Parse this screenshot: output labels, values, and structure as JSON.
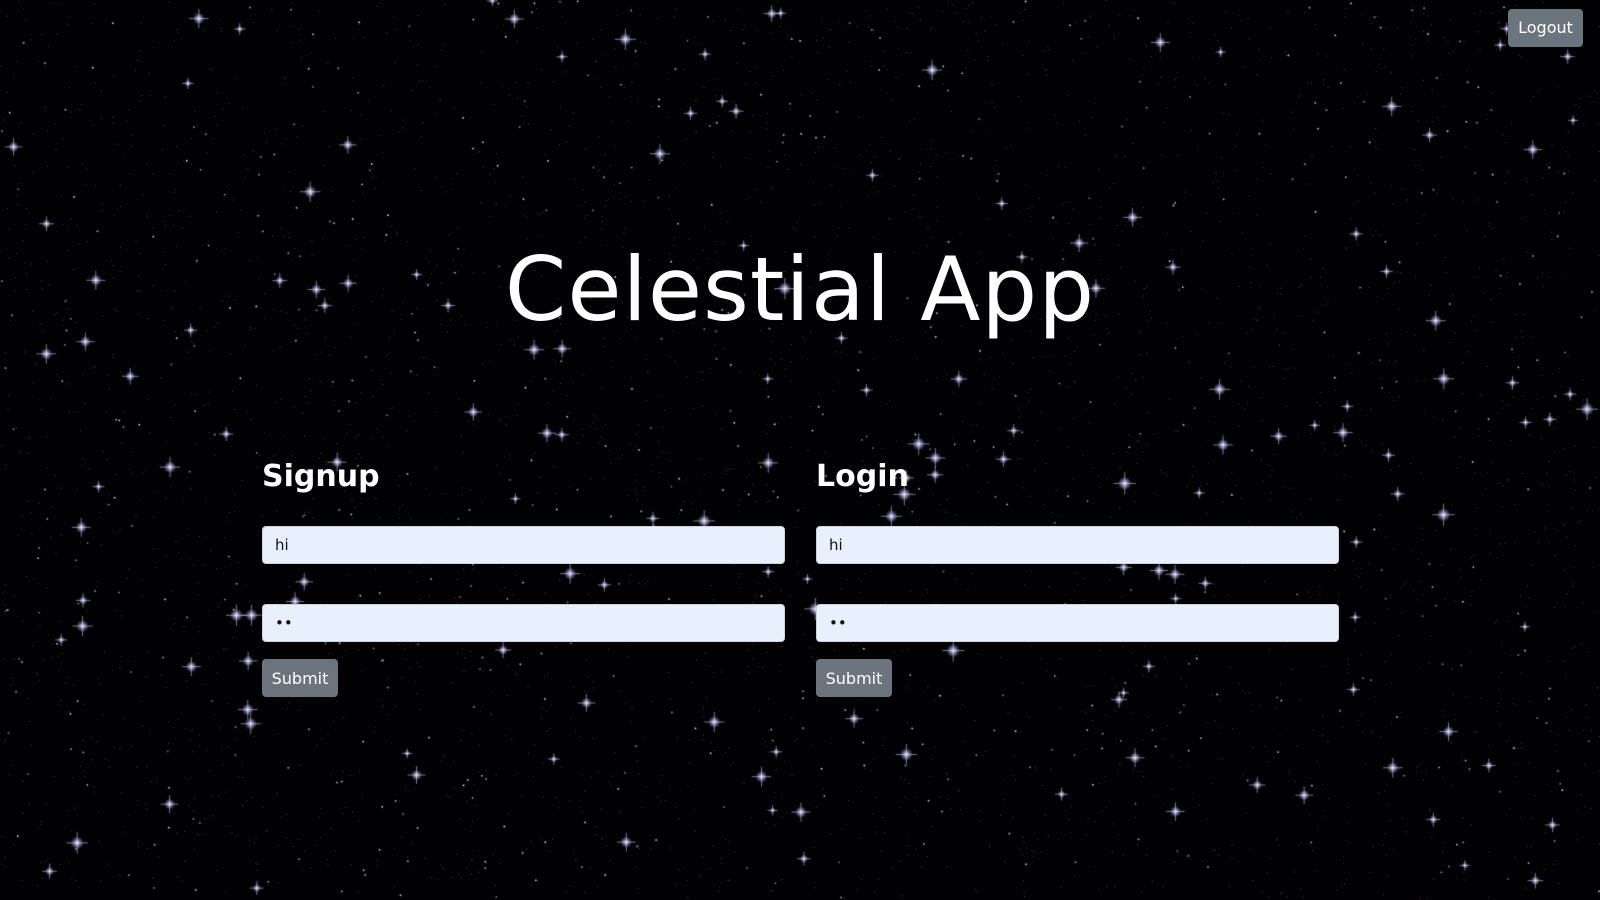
{
  "app": {
    "title": "Celestial App"
  },
  "header": {
    "logout_label": "Logout"
  },
  "signup": {
    "heading": "Signup",
    "username_value": "hi",
    "password_value": "••",
    "submit_label": "Submit"
  },
  "login": {
    "heading": "Login",
    "username_value": "hi",
    "password_value": "••",
    "submit_label": "Submit"
  },
  "colors": {
    "background": "#020104",
    "button": "#6c757d",
    "input_fill": "#e8f0fe",
    "text": "#ffffff"
  }
}
